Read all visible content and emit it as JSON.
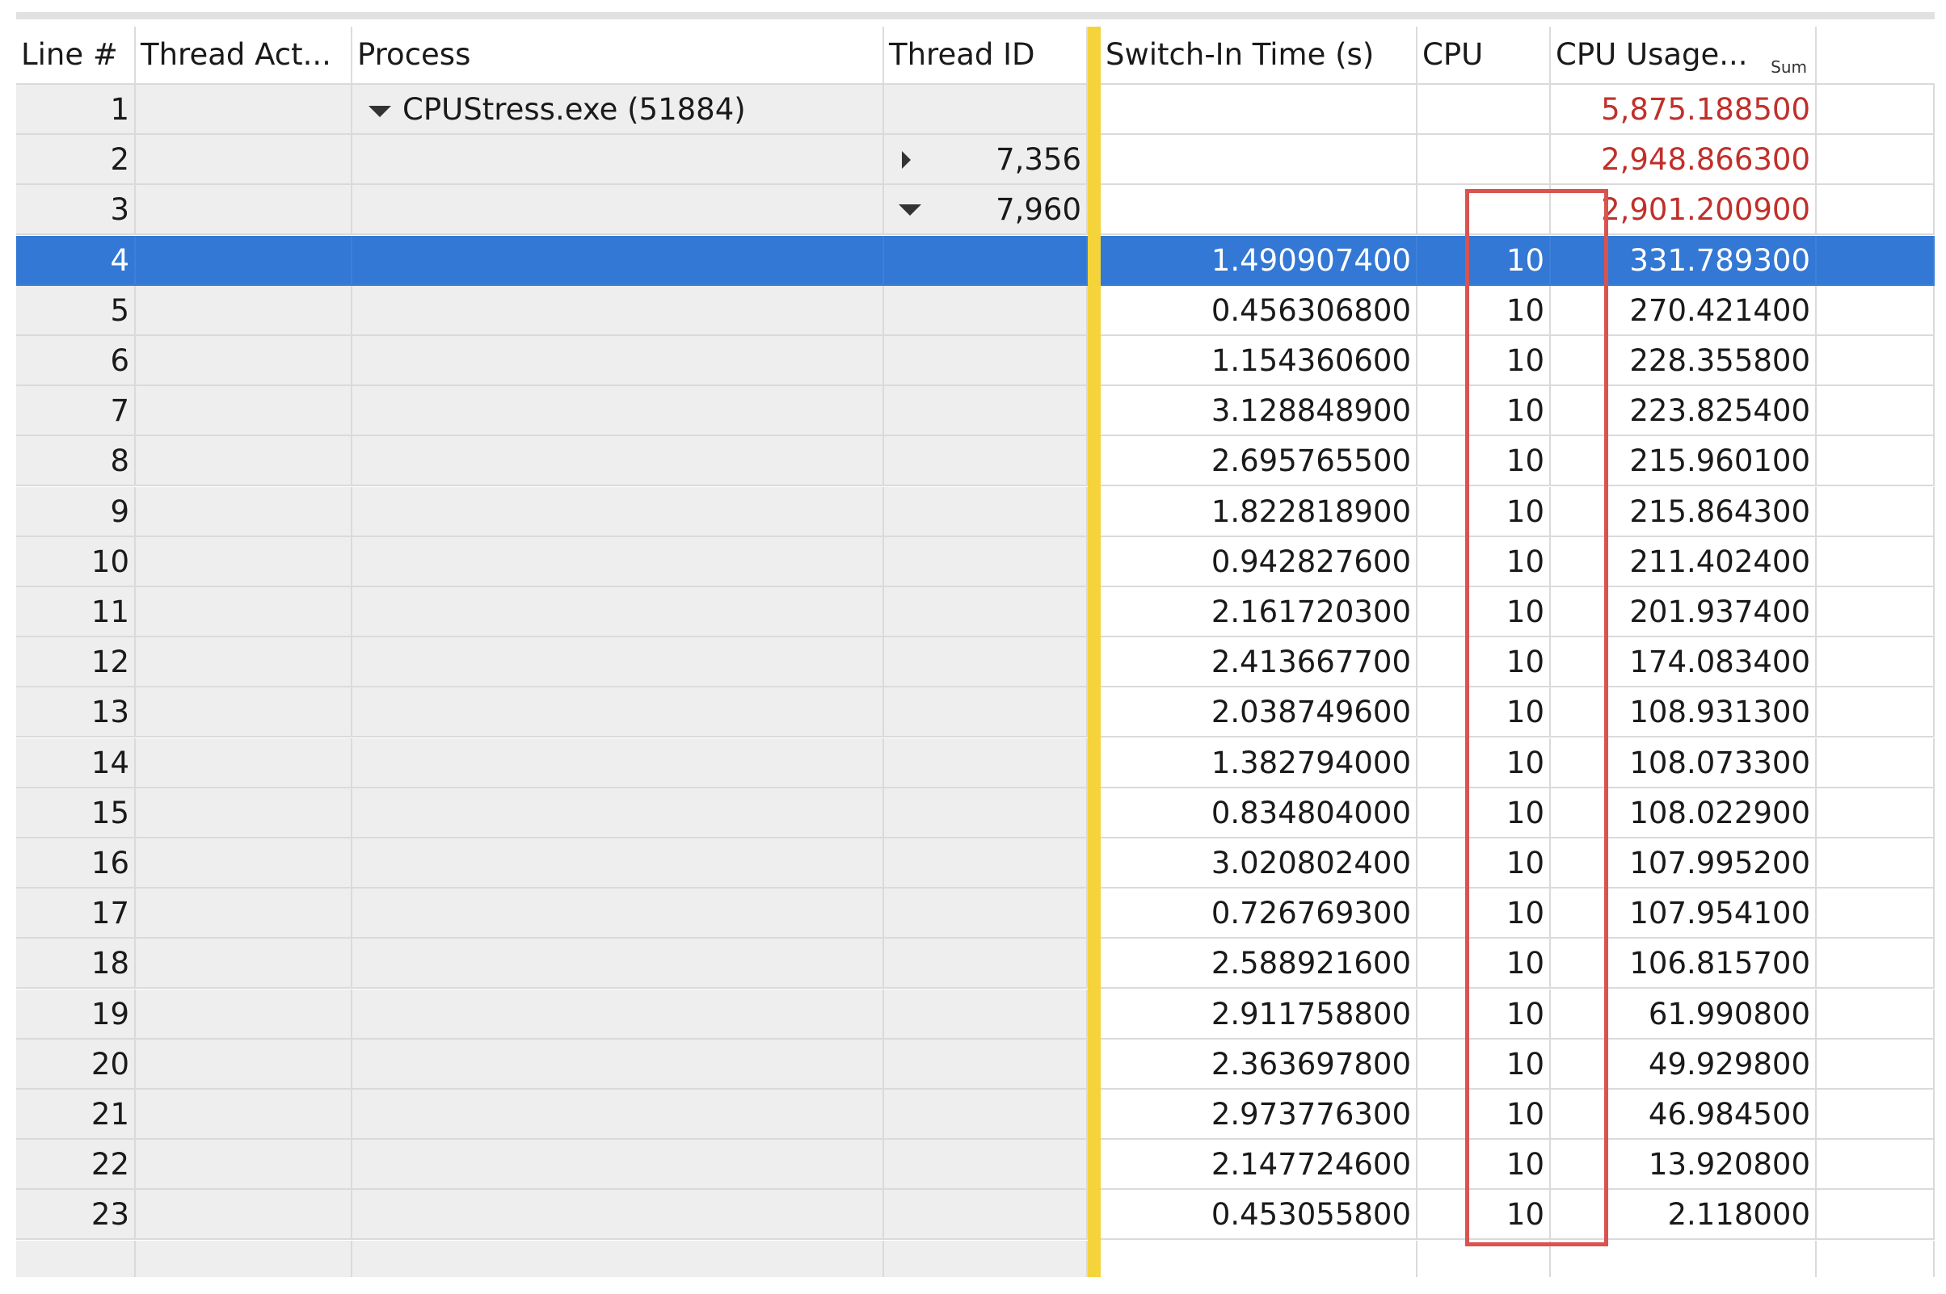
{
  "columns": {
    "line": "Line #",
    "thread_activity": "Thread Act...",
    "process": "Process",
    "thread_id": "Thread ID",
    "switch_in_time": "Switch-In Time (s)",
    "cpu": "CPU",
    "cpu_usage": "CPU Usage...",
    "cpu_usage_agg": "Sum"
  },
  "groups": {
    "process_row": {
      "line": "1",
      "process": "CPUStress.exe (51884)",
      "cpu_usage": "5,875.188500"
    },
    "thread_a": {
      "line": "2",
      "thread_id": "7,356",
      "cpu_usage": "2,948.866300"
    },
    "thread_b": {
      "line": "3",
      "thread_id": "7,960",
      "cpu_usage": "2,901.200900"
    }
  },
  "rows": [
    {
      "line": "4",
      "switch_in": "1.490907400",
      "cpu": "10",
      "usage": "331.789300"
    },
    {
      "line": "5",
      "switch_in": "0.456306800",
      "cpu": "10",
      "usage": "270.421400"
    },
    {
      "line": "6",
      "switch_in": "1.154360600",
      "cpu": "10",
      "usage": "228.355800"
    },
    {
      "line": "7",
      "switch_in": "3.128848900",
      "cpu": "10",
      "usage": "223.825400"
    },
    {
      "line": "8",
      "switch_in": "2.695765500",
      "cpu": "10",
      "usage": "215.960100"
    },
    {
      "line": "9",
      "switch_in": "1.822818900",
      "cpu": "10",
      "usage": "215.864300"
    },
    {
      "line": "10",
      "switch_in": "0.942827600",
      "cpu": "10",
      "usage": "211.402400"
    },
    {
      "line": "11",
      "switch_in": "2.161720300",
      "cpu": "10",
      "usage": "201.937400"
    },
    {
      "line": "12",
      "switch_in": "2.413667700",
      "cpu": "10",
      "usage": "174.083400"
    },
    {
      "line": "13",
      "switch_in": "2.038749600",
      "cpu": "10",
      "usage": "108.931300"
    },
    {
      "line": "14",
      "switch_in": "1.382794000",
      "cpu": "10",
      "usage": "108.073300"
    },
    {
      "line": "15",
      "switch_in": "0.834804000",
      "cpu": "10",
      "usage": "108.022900"
    },
    {
      "line": "16",
      "switch_in": "3.020802400",
      "cpu": "10",
      "usage": "107.995200"
    },
    {
      "line": "17",
      "switch_in": "0.726769300",
      "cpu": "10",
      "usage": "107.954100"
    },
    {
      "line": "18",
      "switch_in": "2.588921600",
      "cpu": "10",
      "usage": "106.815700"
    },
    {
      "line": "19",
      "switch_in": "2.911758800",
      "cpu": "10",
      "usage": "61.990800"
    },
    {
      "line": "20",
      "switch_in": "2.363697800",
      "cpu": "10",
      "usage": "49.929800"
    },
    {
      "line": "21",
      "switch_in": "2.973776300",
      "cpu": "10",
      "usage": "46.984500"
    },
    {
      "line": "22",
      "switch_in": "2.147724600",
      "cpu": "10",
      "usage": "13.920800"
    },
    {
      "line": "23",
      "switch_in": "0.453055800",
      "cpu": "10",
      "usage": "2.118000"
    }
  ],
  "selected_line": "4",
  "colors": {
    "selection": "#3378d4",
    "aggregate_text": "#c0302b",
    "divider": "#f5d33b",
    "highlight_box": "#d9534f"
  },
  "icons": {
    "expanded": "triangle-down-icon",
    "collapsed": "triangle-right-icon"
  }
}
